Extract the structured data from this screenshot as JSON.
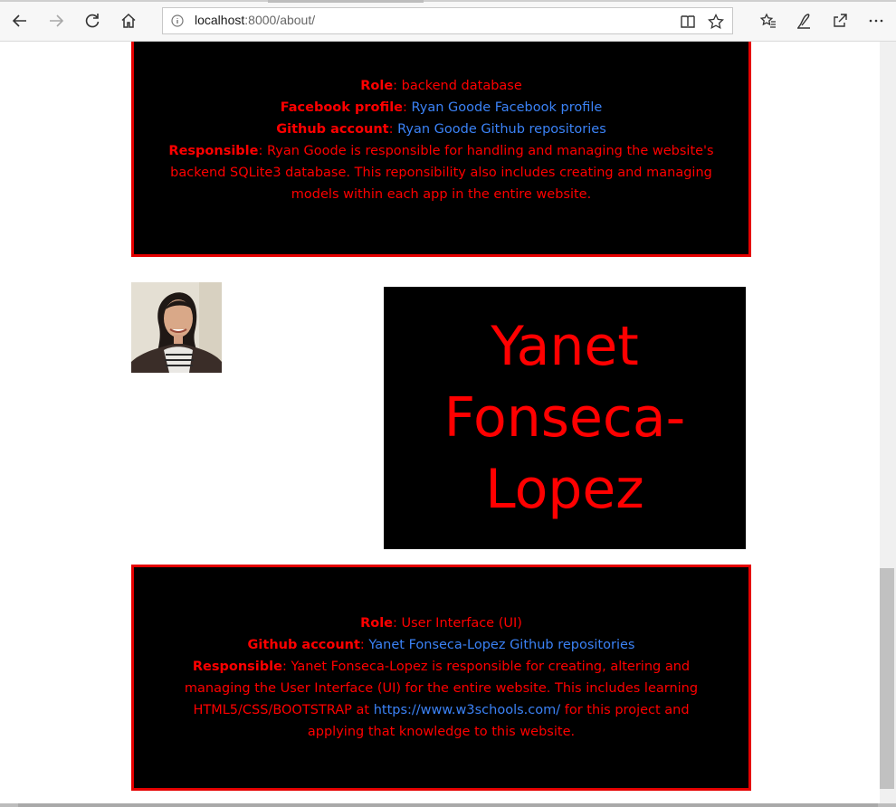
{
  "browser": {
    "url_host": "localhost",
    "url_rest": ":8000/about/"
  },
  "members": [
    {
      "role_label": "Role",
      "role_value": "backend database",
      "facebook_label": "Facebook profile",
      "facebook_link": "Ryan Goode Facebook profile",
      "github_label": "Github account",
      "github_link": "Ryan Goode Github repositories",
      "responsible_label": "Responsible",
      "responsible_lines": [
        "Ryan Goode is responsible for handling and managing the website's",
        "backend SQLite3 database. This reponsibility also includes creating and managing",
        "models within each app in the entire website."
      ]
    },
    {
      "name_lines": [
        "Yanet",
        "Fonseca-",
        "Lopez"
      ],
      "role_label": "Role",
      "role_value": "User Interface (UI)",
      "github_label": "Github account",
      "github_link": "Yanet Fonseca-Lopez Github repositories",
      "responsible_label": "Responsible",
      "responsible_line1": "Yanet Fonseca-Lopez is responsible for creating, altering and",
      "responsible_line2": "managing the User Interface (UI) for the entire website. This includes learning",
      "responsible_line3_pre": "HTML5/CSS/BOOTSTRAP at ",
      "responsible_line3_link": "https://www.w3schools.com/",
      "responsible_line3_post": " for this project and",
      "responsible_line4": "applying that knowledge to this website."
    }
  ],
  "colors": {
    "accent_red": "#ff0000",
    "link_blue": "#3b82f6",
    "card_bg": "#000000"
  }
}
